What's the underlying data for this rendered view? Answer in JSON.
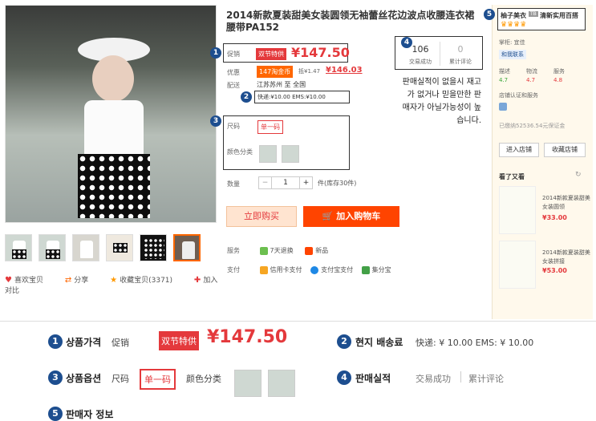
{
  "product": {
    "title": "2014新款夏装甜美女装圆领无袖蕾丝花边波点收腰连衣裙腰带PA152",
    "promo_label": "促销",
    "promo_tag": "双节特供",
    "price": "¥147.50",
    "discount_label": "优惠",
    "discount_tag": "147淘金币",
    "discount_tag2": "抵¥1.47",
    "original_price": "¥146.03",
    "ship_label": "配送",
    "ship_route": "江苏苏州  至  全国",
    "ship_fees": "快递:¥10.00    EMS:¥10.00",
    "size_label": "尺码",
    "size_value": "单一码",
    "color_label": "颜色分类",
    "qty_label": "数量",
    "qty_value": "1",
    "qty_minus": "−",
    "qty_plus": "+",
    "stock_text": "件(库存30件)",
    "buy_now": "立即购买",
    "add_cart": "加入购物车",
    "service_label": "服务",
    "service_1": "7天退换",
    "service_2": "新品",
    "pay_label": "支付",
    "pay_1": "信用卡支付",
    "pay_2": "支付宝支付",
    "pay_3": "集分宝"
  },
  "utilities": {
    "like": "喜欢宝贝",
    "share": "分享",
    "favorite": "收藏宝贝(3371)",
    "compare": "加入对比"
  },
  "sales": {
    "count": "106",
    "count_label": "交易成功",
    "reviews": "0",
    "reviews_label": "累计评论"
  },
  "korean_note": "판매실적이 없을시 재고가 없거나 믿을만한 판매자가 아닐가능성이 높습니다.",
  "seller": {
    "name": "柚子美衣",
    "name_badge": "TB",
    "slogan": "清新实用百搭",
    "manager_label": "掌柜: 宜佳",
    "contact": "和我联系",
    "rate_labels": [
      "描述",
      "物流",
      "服务"
    ],
    "rate_values": [
      "4.7",
      "4.7",
      "4.8"
    ],
    "store_auth": "店铺认证和服务",
    "deposit": "已缴纳52536.54元保证金",
    "enter_store": "进入店铺",
    "fav_store": "收藏店铺",
    "also_viewed": "看了又看",
    "items": [
      {
        "name": "2014新款夏装甜美女装圆领",
        "price": "¥33.00"
      },
      {
        "name": "2014新款夏装甜美女装拼接",
        "price": "¥53.00"
      }
    ]
  },
  "callouts": [
    "1",
    "2",
    "3",
    "4",
    "5"
  ],
  "legend": {
    "item1_title": "상품가격",
    "item1_label": "促销",
    "item1_tag": "双节特供",
    "item1_price": "¥147.50",
    "item2_title": "현지 배송료",
    "item2_value": "快递: ¥ 10.00    EMS: ¥ 10.00",
    "item3_title": "상품옵션",
    "item3_size_label": "尺码",
    "item3_size": "单一码",
    "item3_color_label": "颜色分类",
    "item4_title": "판매실적",
    "item4_a": "交易成功",
    "item4_b": "累计评论",
    "item5_title": "판매자 정보"
  },
  "colors": {
    "accent": "#e4393c",
    "cart": "#ff4400",
    "callout": "#1d4e8f"
  }
}
